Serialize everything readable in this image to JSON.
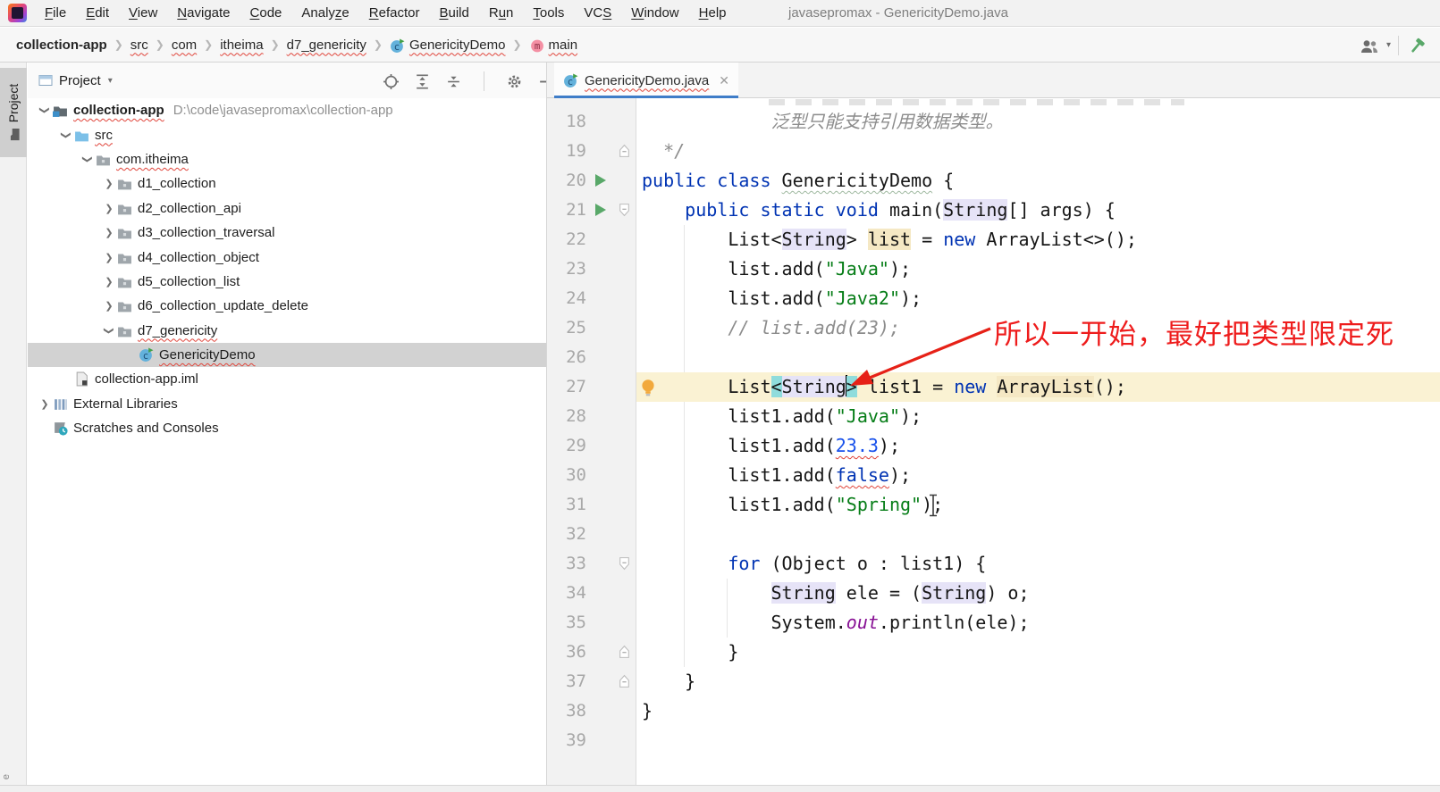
{
  "window": {
    "title": "javasepromax - GenericityDemo.java"
  },
  "menu_bar": {
    "items": [
      {
        "label": "File",
        "u": 0
      },
      {
        "label": "Edit",
        "u": 0
      },
      {
        "label": "View",
        "u": 0
      },
      {
        "label": "Navigate",
        "u": 0
      },
      {
        "label": "Code",
        "u": 0
      },
      {
        "label": "Analyze",
        "u": 5
      },
      {
        "label": "Refactor",
        "u": 0
      },
      {
        "label": "Build",
        "u": 0
      },
      {
        "label": "Run",
        "u": 1
      },
      {
        "label": "Tools",
        "u": 0
      },
      {
        "label": "VCS",
        "u": 2
      },
      {
        "label": "Window",
        "u": 0
      },
      {
        "label": "Help",
        "u": 0
      }
    ]
  },
  "breadcrumb_bar": {
    "items": [
      {
        "label": "collection-app",
        "bold": true
      },
      {
        "label": "src",
        "wavy": true
      },
      {
        "label": "com",
        "wavy": true
      },
      {
        "label": "itheima",
        "wavy": true
      },
      {
        "label": "d7_genericity",
        "wavy": true
      },
      {
        "label": "GenericityDemo",
        "wavy": true,
        "icon": "class"
      },
      {
        "label": "main",
        "wavy": true,
        "icon": "method"
      }
    ],
    "right_icons": [
      "users-icon",
      "dropdown-caret",
      "build-hammer-icon"
    ]
  },
  "left_stripe": {
    "tab_label": "Project",
    "bottom_fragment": "e"
  },
  "project_panel": {
    "title": "Project",
    "header_icons": [
      "locate-icon",
      "expand-all-icon",
      "collapse-all-icon",
      "settings-gear-icon",
      "hide-panel-icon"
    ],
    "tree": [
      {
        "label": "collection-app",
        "suffix": "D:\\code\\javasepromax\\collection-app",
        "depth": 0,
        "icon": "project",
        "chevron": "open",
        "bold": true,
        "wavy": true
      },
      {
        "label": "src",
        "depth": 1,
        "icon": "src",
        "chevron": "open",
        "wavy": true
      },
      {
        "label": "com.itheima",
        "depth": 2,
        "icon": "package",
        "chevron": "open",
        "wavy": true
      },
      {
        "label": "d1_collection",
        "depth": 3,
        "icon": "package",
        "chevron": "closed"
      },
      {
        "label": "d2_collection_api",
        "depth": 3,
        "icon": "package",
        "chevron": "closed"
      },
      {
        "label": "d3_collection_traversal",
        "depth": 3,
        "icon": "package",
        "chevron": "closed"
      },
      {
        "label": "d4_collection_object",
        "depth": 3,
        "icon": "package",
        "chevron": "closed"
      },
      {
        "label": "d5_collection_list",
        "depth": 3,
        "icon": "package",
        "chevron": "closed"
      },
      {
        "label": "d6_collection_update_delete",
        "depth": 3,
        "icon": "package",
        "chevron": "closed"
      },
      {
        "label": "d7_genericity",
        "depth": 3,
        "icon": "package",
        "chevron": "open",
        "wavy": true
      },
      {
        "label": "GenericityDemo",
        "depth": 4,
        "icon": "class",
        "selected": true,
        "wavy": true
      },
      {
        "label": "collection-app.iml",
        "depth": 1,
        "icon": "iml"
      },
      {
        "label": "External Libraries",
        "depth": 0,
        "icon": "lib",
        "chevron": "closed"
      },
      {
        "label": "Scratches and Consoles",
        "depth": 0,
        "icon": "scratch"
      }
    ]
  },
  "editor": {
    "tab": {
      "label": "GenericityDemo.java",
      "icon": "class",
      "close": "✕"
    },
    "lines": [
      {
        "num": 18,
        "segs": [
          {
            "t": "            泛型只能支持引用数据类型。",
            "c": "cmt"
          }
        ]
      },
      {
        "num": 19,
        "fold": "up",
        "segs": [
          {
            "t": "  */",
            "c": "cmt"
          }
        ]
      },
      {
        "num": 20,
        "gutter": "run",
        "segs": [
          {
            "t": "public class ",
            "c": "kw"
          },
          {
            "t": "GenericityDemo",
            "c": "pl wavy-green"
          },
          {
            "t": " {",
            "c": "pl"
          }
        ]
      },
      {
        "num": 21,
        "gutter": "run",
        "fold": "down",
        "segs": [
          {
            "t": "    ",
            "c": "pl"
          },
          {
            "t": "public static void ",
            "c": "kw"
          },
          {
            "t": "main(",
            "c": "pl"
          },
          {
            "t": "String",
            "c": "pl hl-lav"
          },
          {
            "t": "[] args) {",
            "c": "pl"
          }
        ]
      },
      {
        "num": 22,
        "segs": [
          {
            "t": "        List<",
            "c": "pl"
          },
          {
            "t": "String",
            "c": "pl hl-lav"
          },
          {
            "t": "> ",
            "c": "pl"
          },
          {
            "t": "list",
            "c": "pl hl-tan"
          },
          {
            "t": " = ",
            "c": "pl"
          },
          {
            "t": "new",
            "c": "kw"
          },
          {
            "t": " ArrayList<>();",
            "c": "pl"
          }
        ]
      },
      {
        "num": 23,
        "segs": [
          {
            "t": "        list.add(",
            "c": "pl"
          },
          {
            "t": "\"Java\"",
            "c": "str"
          },
          {
            "t": ");",
            "c": "pl"
          }
        ]
      },
      {
        "num": 24,
        "segs": [
          {
            "t": "        list.add(",
            "c": "pl"
          },
          {
            "t": "\"Java2\"",
            "c": "str"
          },
          {
            "t": ");",
            "c": "pl"
          }
        ]
      },
      {
        "num": 25,
        "segs": [
          {
            "t": "        ",
            "c": "pl"
          },
          {
            "t": "// list.add(23);",
            "c": "cmt"
          }
        ]
      },
      {
        "num": 26,
        "segs": []
      },
      {
        "num": 27,
        "gutter": "bulb",
        "current": true,
        "segs": [
          {
            "t": "        List",
            "c": "pl"
          },
          {
            "t": "<",
            "c": "pl hl-teal"
          },
          {
            "t": "String",
            "c": "pl hl-lav"
          },
          {
            "caret": true
          },
          {
            "t": ">",
            "c": "pl hl-teal"
          },
          {
            "t": " list1 = ",
            "c": "pl"
          },
          {
            "t": "new",
            "c": "kw"
          },
          {
            "t": " ",
            "c": "pl"
          },
          {
            "t": "ArrayList",
            "c": "pl hl-tan"
          },
          {
            "t": "();",
            "c": "pl"
          }
        ]
      },
      {
        "num": 28,
        "segs": [
          {
            "t": "        list1.add(",
            "c": "pl"
          },
          {
            "t": "\"Java\"",
            "c": "str"
          },
          {
            "t": ");",
            "c": "pl"
          }
        ]
      },
      {
        "num": 29,
        "segs": [
          {
            "t": "        list1.add(",
            "c": "pl"
          },
          {
            "t": "23.3",
            "c": "num wavy-red"
          },
          {
            "t": ");",
            "c": "pl"
          }
        ]
      },
      {
        "num": 30,
        "segs": [
          {
            "t": "        list1.add(",
            "c": "pl"
          },
          {
            "t": "false",
            "c": "kw wavy-red"
          },
          {
            "t": ");",
            "c": "pl"
          }
        ]
      },
      {
        "num": 31,
        "ibeam": true,
        "segs": [
          {
            "t": "        list1.add(",
            "c": "pl"
          },
          {
            "t": "\"Spring\"",
            "c": "str"
          },
          {
            "t": ");",
            "c": "pl"
          }
        ]
      },
      {
        "num": 32,
        "segs": []
      },
      {
        "num": 33,
        "fold": "down",
        "segs": [
          {
            "t": "        ",
            "c": "pl"
          },
          {
            "t": "for",
            "c": "kw"
          },
          {
            "t": " (Object o : list1) {",
            "c": "pl"
          }
        ]
      },
      {
        "num": 34,
        "segs": [
          {
            "t": "            ",
            "c": "pl"
          },
          {
            "t": "String",
            "c": "pl hl-lav"
          },
          {
            "t": " ele = (",
            "c": "pl"
          },
          {
            "t": "String",
            "c": "pl hl-lav"
          },
          {
            "t": ") o;",
            "c": "pl"
          }
        ]
      },
      {
        "num": 35,
        "segs": [
          {
            "t": "            System.",
            "c": "pl"
          },
          {
            "t": "out",
            "c": "fld"
          },
          {
            "t": ".println(ele);",
            "c": "pl"
          }
        ]
      },
      {
        "num": 36,
        "fold": "up",
        "segs": [
          {
            "t": "        }",
            "c": "pl"
          }
        ]
      },
      {
        "num": 37,
        "fold": "up",
        "segs": [
          {
            "t": "    }",
            "c": "pl"
          }
        ]
      },
      {
        "num": 38,
        "segs": [
          {
            "t": "}",
            "c": "pl"
          }
        ]
      },
      {
        "num": 39,
        "segs": []
      }
    ]
  },
  "annotation": {
    "text": "所以一开始，最好把类型限定死",
    "color": "#EE1C1C"
  },
  "colors": {
    "keyword": "#0033B3",
    "string": "#067D17",
    "number": "#1750EB",
    "comment": "#8C8C8C",
    "field": "#871094",
    "caret_row": "#FAF2D3",
    "brace_match_teal": "#8FDCDC",
    "identifier_highlight": "#E6E3F7",
    "write_highlight": "#F5E8C4",
    "tab_underline": "#3F7DC8",
    "run_green": "#59A869",
    "annotation_red": "#EE1C1C",
    "selection_gray": "#D2D2D2"
  }
}
